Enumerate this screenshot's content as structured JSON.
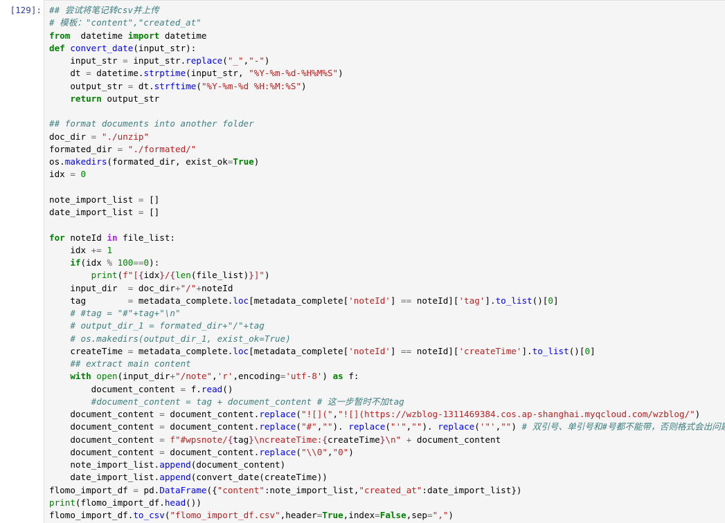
{
  "cell": {
    "prompt": "[129]:",
    "lines": [
      [
        [
          "cm",
          "## 尝试将笔记转csv并上传"
        ]
      ],
      [
        [
          "cm",
          "# 模板：\"content\",\"created_at\""
        ]
      ],
      [
        [
          "kw",
          "from"
        ],
        [
          "",
          "  datetime "
        ],
        [
          "kw",
          "import"
        ],
        [
          "",
          " datetime"
        ]
      ],
      [
        [
          "kw",
          "def"
        ],
        [
          "",
          " "
        ],
        [
          "fn",
          "convert_date"
        ],
        [
          "",
          "(input_str):"
        ]
      ],
      [
        [
          "",
          "    input_str "
        ],
        [
          "op",
          "="
        ],
        [
          "",
          " input_str."
        ],
        [
          "fn",
          "replace"
        ],
        [
          "",
          "("
        ],
        [
          "st",
          "\"_\""
        ],
        [
          "",
          ","
        ],
        [
          "st",
          "\"-\""
        ],
        [
          "",
          ")"
        ]
      ],
      [
        [
          "",
          "    dt "
        ],
        [
          "op",
          "="
        ],
        [
          "",
          " datetime."
        ],
        [
          "fn",
          "strptime"
        ],
        [
          "",
          "(input_str, "
        ],
        [
          "st",
          "\"%Y-%m-%d-%H%M%S\""
        ],
        [
          "",
          ")"
        ]
      ],
      [
        [
          "",
          "    output_str "
        ],
        [
          "op",
          "="
        ],
        [
          "",
          " dt."
        ],
        [
          "fn",
          "strftime"
        ],
        [
          "",
          "("
        ],
        [
          "st",
          "\"%Y-%m-%d %H:%M:%S\""
        ],
        [
          "",
          ")"
        ]
      ],
      [
        [
          "",
          "    "
        ],
        [
          "kw",
          "return"
        ],
        [
          "",
          " output_str"
        ]
      ],
      [],
      [
        [
          "cm",
          "## format documents into another folder"
        ]
      ],
      [
        [
          "",
          "doc_dir "
        ],
        [
          "op",
          "="
        ],
        [
          "",
          " "
        ],
        [
          "st",
          "\"./unzip\""
        ]
      ],
      [
        [
          "",
          "formated_dir "
        ],
        [
          "op",
          "="
        ],
        [
          "",
          " "
        ],
        [
          "st",
          "\"./formated/\""
        ]
      ],
      [
        [
          "",
          "os."
        ],
        [
          "fn",
          "makedirs"
        ],
        [
          "",
          "(formated_dir, exist_ok"
        ],
        [
          "op",
          "="
        ],
        [
          "kw",
          "True"
        ],
        [
          "",
          ")"
        ]
      ],
      [
        [
          "",
          "idx "
        ],
        [
          "op",
          "="
        ],
        [
          "",
          " "
        ],
        [
          "nu",
          "0"
        ]
      ],
      [],
      [
        [
          "",
          "note_import_list "
        ],
        [
          "op",
          "="
        ],
        [
          "",
          " []"
        ]
      ],
      [
        [
          "",
          "date_import_list "
        ],
        [
          "op",
          "="
        ],
        [
          "",
          " []"
        ]
      ],
      [],
      [
        [
          "kw",
          "for"
        ],
        [
          "",
          " noteId "
        ],
        [
          "ow",
          "in"
        ],
        [
          "",
          " file_list:"
        ]
      ],
      [
        [
          "",
          "    idx "
        ],
        [
          "op",
          "+="
        ],
        [
          "",
          " "
        ],
        [
          "nu",
          "1"
        ]
      ],
      [
        [
          "",
          "    "
        ],
        [
          "kw",
          "if"
        ],
        [
          "",
          "(idx "
        ],
        [
          "op",
          "%"
        ],
        [
          "",
          " "
        ],
        [
          "nu",
          "100"
        ],
        [
          "op",
          "=="
        ],
        [
          "nu",
          "0"
        ],
        [
          "",
          "):"
        ]
      ],
      [
        [
          "",
          "        "
        ],
        [
          "bi",
          "print"
        ],
        [
          "",
          "("
        ],
        [
          "st",
          "f\"["
        ],
        [
          "ph",
          "{"
        ],
        [
          "",
          "idx"
        ],
        [
          "ph",
          "}"
        ],
        [
          "st",
          "/"
        ],
        [
          "ph",
          "{"
        ],
        [
          "bi",
          "len"
        ],
        [
          "",
          "(file_list)"
        ],
        [
          "ph",
          "}"
        ],
        [
          "st",
          "]\""
        ],
        [
          "",
          ")"
        ]
      ],
      [
        [
          "",
          "    input_dir  "
        ],
        [
          "op",
          "="
        ],
        [
          "",
          " doc_dir"
        ],
        [
          "op",
          "+"
        ],
        [
          "st",
          "\"/\""
        ],
        [
          "op",
          "+"
        ],
        [
          "",
          "noteId"
        ]
      ],
      [
        [
          "",
          "    tag        "
        ],
        [
          "op",
          "="
        ],
        [
          "",
          " metadata_complete."
        ],
        [
          "fn",
          "loc"
        ],
        [
          "",
          "[metadata_complete["
        ],
        [
          "st",
          "'noteId'"
        ],
        [
          "",
          "] "
        ],
        [
          "op",
          "=="
        ],
        [
          "",
          " noteId]["
        ],
        [
          "st",
          "'tag'"
        ],
        [
          "",
          "]."
        ],
        [
          "fn",
          "to_list"
        ],
        [
          "",
          "()["
        ],
        [
          "nu",
          "0"
        ],
        [
          "",
          "]"
        ]
      ],
      [
        [
          "",
          "    "
        ],
        [
          "cm",
          "# #tag = \"#\"+tag+\"\\n\""
        ]
      ],
      [
        [
          "",
          "    "
        ],
        [
          "cm",
          "# output_dir_1 = formated_dir+\"/\"+tag"
        ]
      ],
      [
        [
          "",
          "    "
        ],
        [
          "cm",
          "# os.makedirs(output_dir_1, exist_ok=True)"
        ]
      ],
      [
        [
          "",
          "    createTime "
        ],
        [
          "op",
          "="
        ],
        [
          "",
          " metadata_complete."
        ],
        [
          "fn",
          "loc"
        ],
        [
          "",
          "[metadata_complete["
        ],
        [
          "st",
          "'noteId'"
        ],
        [
          "",
          "] "
        ],
        [
          "op",
          "=="
        ],
        [
          "",
          " noteId]["
        ],
        [
          "st",
          "'createTime'"
        ],
        [
          "",
          "]."
        ],
        [
          "fn",
          "to_list"
        ],
        [
          "",
          "()["
        ],
        [
          "nu",
          "0"
        ],
        [
          "",
          "]"
        ]
      ],
      [
        [
          "",
          "    "
        ],
        [
          "cm",
          "## extract main content"
        ]
      ],
      [
        [
          "",
          "    "
        ],
        [
          "kw",
          "with"
        ],
        [
          "",
          " "
        ],
        [
          "bi",
          "open"
        ],
        [
          "",
          "(input_dir"
        ],
        [
          "op",
          "+"
        ],
        [
          "st",
          "\"/note\""
        ],
        [
          "",
          ","
        ],
        [
          "st",
          "'r'"
        ],
        [
          "",
          ",encoding"
        ],
        [
          "op",
          "="
        ],
        [
          "st",
          "'utf-8'"
        ],
        [
          "",
          ") "
        ],
        [
          "kw",
          "as"
        ],
        [
          "",
          " f:"
        ]
      ],
      [
        [
          "",
          "        document_content "
        ],
        [
          "op",
          "="
        ],
        [
          "",
          " f."
        ],
        [
          "fn",
          "read"
        ],
        [
          "",
          "()"
        ]
      ],
      [
        [
          "",
          "        "
        ],
        [
          "cm",
          "#document_content = tag + document_content # 这一步暂时不加tag"
        ]
      ],
      [
        [
          "",
          "    document_content "
        ],
        [
          "op",
          "="
        ],
        [
          "",
          " document_content."
        ],
        [
          "fn",
          "replace"
        ],
        [
          "",
          "("
        ],
        [
          "st",
          "\"![](\""
        ],
        [
          "",
          ","
        ],
        [
          "st",
          "\"![](https://wzblog-1311469384.cos.ap-shanghai.myqcloud.com/wzblog/\""
        ],
        [
          "",
          ")"
        ]
      ],
      [
        [
          "",
          "    document_content "
        ],
        [
          "op",
          "="
        ],
        [
          "",
          " document_content."
        ],
        [
          "fn",
          "replace"
        ],
        [
          "",
          "("
        ],
        [
          "st",
          "\"#\""
        ],
        [
          "",
          ","
        ],
        [
          "st",
          "\"\""
        ],
        [
          "",
          "). "
        ],
        [
          "fn",
          "replace"
        ],
        [
          "",
          "("
        ],
        [
          "st",
          "\"'\""
        ],
        [
          "",
          ","
        ],
        [
          "st",
          "\"\""
        ],
        [
          "",
          "). "
        ],
        [
          "fn",
          "replace"
        ],
        [
          "",
          "("
        ],
        [
          "st",
          "'\"'"
        ],
        [
          "",
          ","
        ],
        [
          "st",
          "\"\""
        ],
        [
          "",
          ") "
        ],
        [
          "cm",
          "# 双引号、单引号和#号都不能带，否则格式会出问题"
        ]
      ],
      [
        [
          "",
          "    document_content "
        ],
        [
          "op",
          "="
        ],
        [
          "",
          " "
        ],
        [
          "st",
          "f\"#wpsnote/"
        ],
        [
          "ph",
          "{"
        ],
        [
          "",
          "tag"
        ],
        [
          "ph",
          "}"
        ],
        [
          "st",
          "\\ncreateTime:"
        ],
        [
          "ph",
          "{"
        ],
        [
          "",
          "createTime"
        ],
        [
          "ph",
          "}"
        ],
        [
          "st",
          "\\n\""
        ],
        [
          "",
          ""
        ],
        [
          "op",
          " +"
        ],
        [
          "",
          " document_content"
        ]
      ],
      [
        [
          "",
          "    document_content "
        ],
        [
          "op",
          "="
        ],
        [
          "",
          " document_content."
        ],
        [
          "fn",
          "replace"
        ],
        [
          "",
          "("
        ],
        [
          "st",
          "\"\\\\0\""
        ],
        [
          "",
          ","
        ],
        [
          "st",
          "\"0\""
        ],
        [
          "",
          ")"
        ]
      ],
      [
        [
          "",
          "    note_import_list."
        ],
        [
          "fn",
          "append"
        ],
        [
          "",
          "(document_content)"
        ]
      ],
      [
        [
          "",
          "    date_import_list."
        ],
        [
          "fn",
          "append"
        ],
        [
          "",
          "(convert_date(createTime))"
        ]
      ],
      [
        [
          "",
          "flomo_import_df "
        ],
        [
          "op",
          "="
        ],
        [
          "",
          " pd."
        ],
        [
          "fn",
          "DataFrame"
        ],
        [
          "",
          "({"
        ],
        [
          "st",
          "\"content\""
        ],
        [
          "",
          ":note_import_list,"
        ],
        [
          "st",
          "\"created_at\""
        ],
        [
          "",
          ":date_import_list})"
        ]
      ],
      [
        [
          "bi",
          "print"
        ],
        [
          "",
          "(flomo_import_df."
        ],
        [
          "fn",
          "head"
        ],
        [
          "",
          "())"
        ]
      ],
      [
        [
          "",
          "flomo_import_df."
        ],
        [
          "fn",
          "to_csv"
        ],
        [
          "",
          "("
        ],
        [
          "st",
          "\"flomo_import_df.csv\""
        ],
        [
          "",
          ",header"
        ],
        [
          "op",
          "="
        ],
        [
          "kw",
          "True"
        ],
        [
          "",
          ",index"
        ],
        [
          "op",
          "="
        ],
        [
          "kw",
          "False"
        ],
        [
          "",
          ",sep"
        ],
        [
          "op",
          "="
        ],
        [
          "st",
          "\",\""
        ],
        [
          "",
          ")"
        ]
      ]
    ]
  }
}
